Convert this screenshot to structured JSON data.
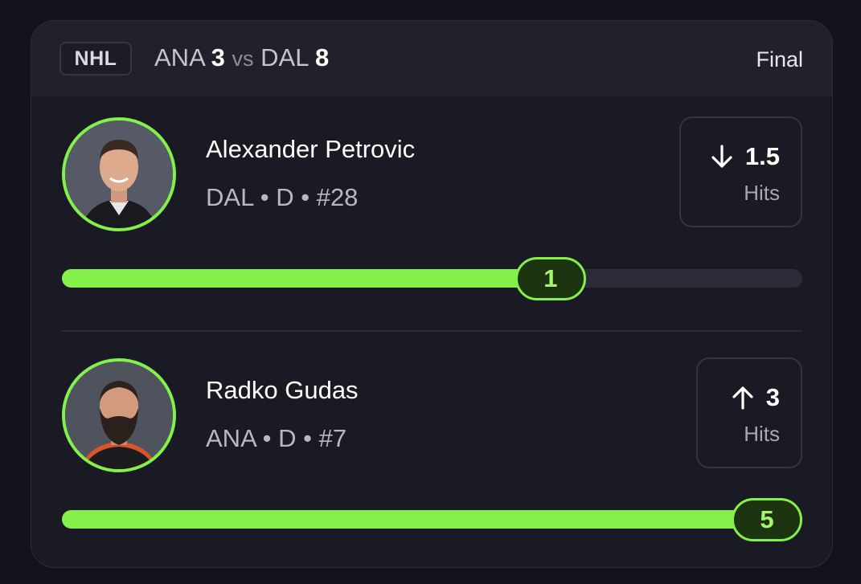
{
  "header": {
    "league": "NHL",
    "team_a": "ANA",
    "score_a": "3",
    "vs": "vs",
    "team_b": "DAL",
    "score_b": "8",
    "status": "Final"
  },
  "players": [
    {
      "name": "Alexander Petrovic",
      "meta": "DAL • D • #28",
      "direction": "under",
      "direction_icon": "arrow-down-icon",
      "line": "1.5",
      "stat": "Hits",
      "result": "1",
      "progress_fraction": 0.66
    },
    {
      "name": "Radko Gudas",
      "meta": "ANA • D • #7",
      "direction": "over",
      "direction_icon": "arrow-up-icon",
      "line": "3",
      "stat": "Hits",
      "result": "5",
      "progress_fraction": 1.0
    }
  ],
  "colors": {
    "accent": "#84f04a",
    "background": "#13131b",
    "card": "#191a24",
    "header": "#20212b"
  }
}
